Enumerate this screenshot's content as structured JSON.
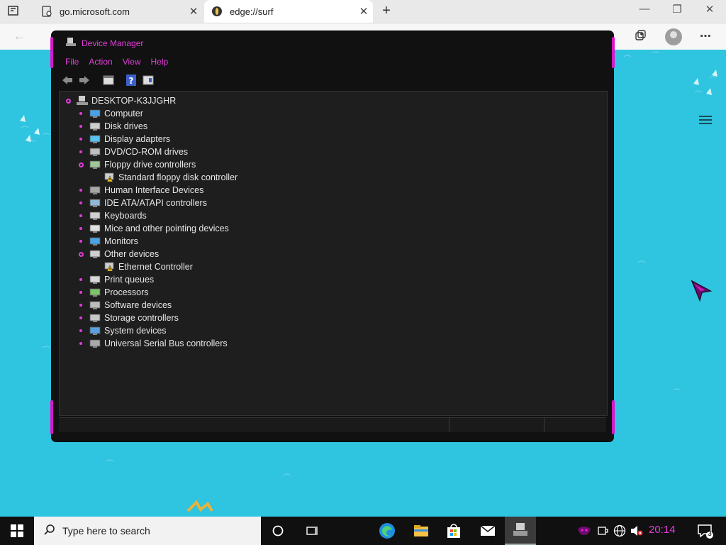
{
  "browser": {
    "tabs": [
      {
        "title": "go.microsoft.com",
        "active": false
      },
      {
        "title": "edge://surf",
        "active": true
      }
    ],
    "new_tab_icon": "plus-icon",
    "window_controls": [
      "minimize-icon",
      "restore-icon",
      "close-icon"
    ]
  },
  "device_manager": {
    "title": "Device Manager",
    "menu": [
      "File",
      "Action",
      "View",
      "Help"
    ],
    "toolbar_icons": [
      "back-icon",
      "forward-icon",
      "properties-icon",
      "help-icon",
      "view-icon"
    ],
    "root": "DESKTOP-K3JJGHR",
    "categories": [
      {
        "label": "Computer",
        "icon": "computer-icon",
        "expanded": false
      },
      {
        "label": "Disk drives",
        "icon": "disk-drive-icon",
        "expanded": false
      },
      {
        "label": "Display adapters",
        "icon": "display-adapter-icon",
        "expanded": false
      },
      {
        "label": "DVD/CD-ROM drives",
        "icon": "dvd-drive-icon",
        "expanded": false
      },
      {
        "label": "Floppy drive controllers",
        "icon": "floppy-controller-icon",
        "expanded": true,
        "children": [
          {
            "label": "Standard floppy disk controller",
            "icon": "warning-device-icon"
          }
        ]
      },
      {
        "label": "Human Interface Devices",
        "icon": "hid-icon",
        "expanded": false
      },
      {
        "label": "IDE ATA/ATAPI controllers",
        "icon": "ide-controller-icon",
        "expanded": false
      },
      {
        "label": "Keyboards",
        "icon": "keyboard-icon",
        "expanded": false
      },
      {
        "label": "Mice and other pointing devices",
        "icon": "mouse-icon",
        "expanded": false
      },
      {
        "label": "Monitors",
        "icon": "monitor-icon",
        "expanded": false
      },
      {
        "label": "Other devices",
        "icon": "other-devices-icon",
        "expanded": true,
        "children": [
          {
            "label": "Ethernet Controller",
            "icon": "warning-device-icon"
          }
        ]
      },
      {
        "label": "Print queues",
        "icon": "printer-icon",
        "expanded": false
      },
      {
        "label": "Processors",
        "icon": "processor-icon",
        "expanded": false
      },
      {
        "label": "Software devices",
        "icon": "software-device-icon",
        "expanded": false
      },
      {
        "label": "Storage controllers",
        "icon": "storage-controller-icon",
        "expanded": false
      },
      {
        "label": "System devices",
        "icon": "system-devices-icon",
        "expanded": false
      },
      {
        "label": "Universal Serial Bus controllers",
        "icon": "usb-icon",
        "expanded": false
      }
    ]
  },
  "taskbar": {
    "search_placeholder": "Type here to search",
    "clock": "20:14",
    "notification_count": "3"
  },
  "colors": {
    "accent": "#e33ddb",
    "sea": "#2fc4df",
    "window_bg": "#1e1e1e"
  }
}
